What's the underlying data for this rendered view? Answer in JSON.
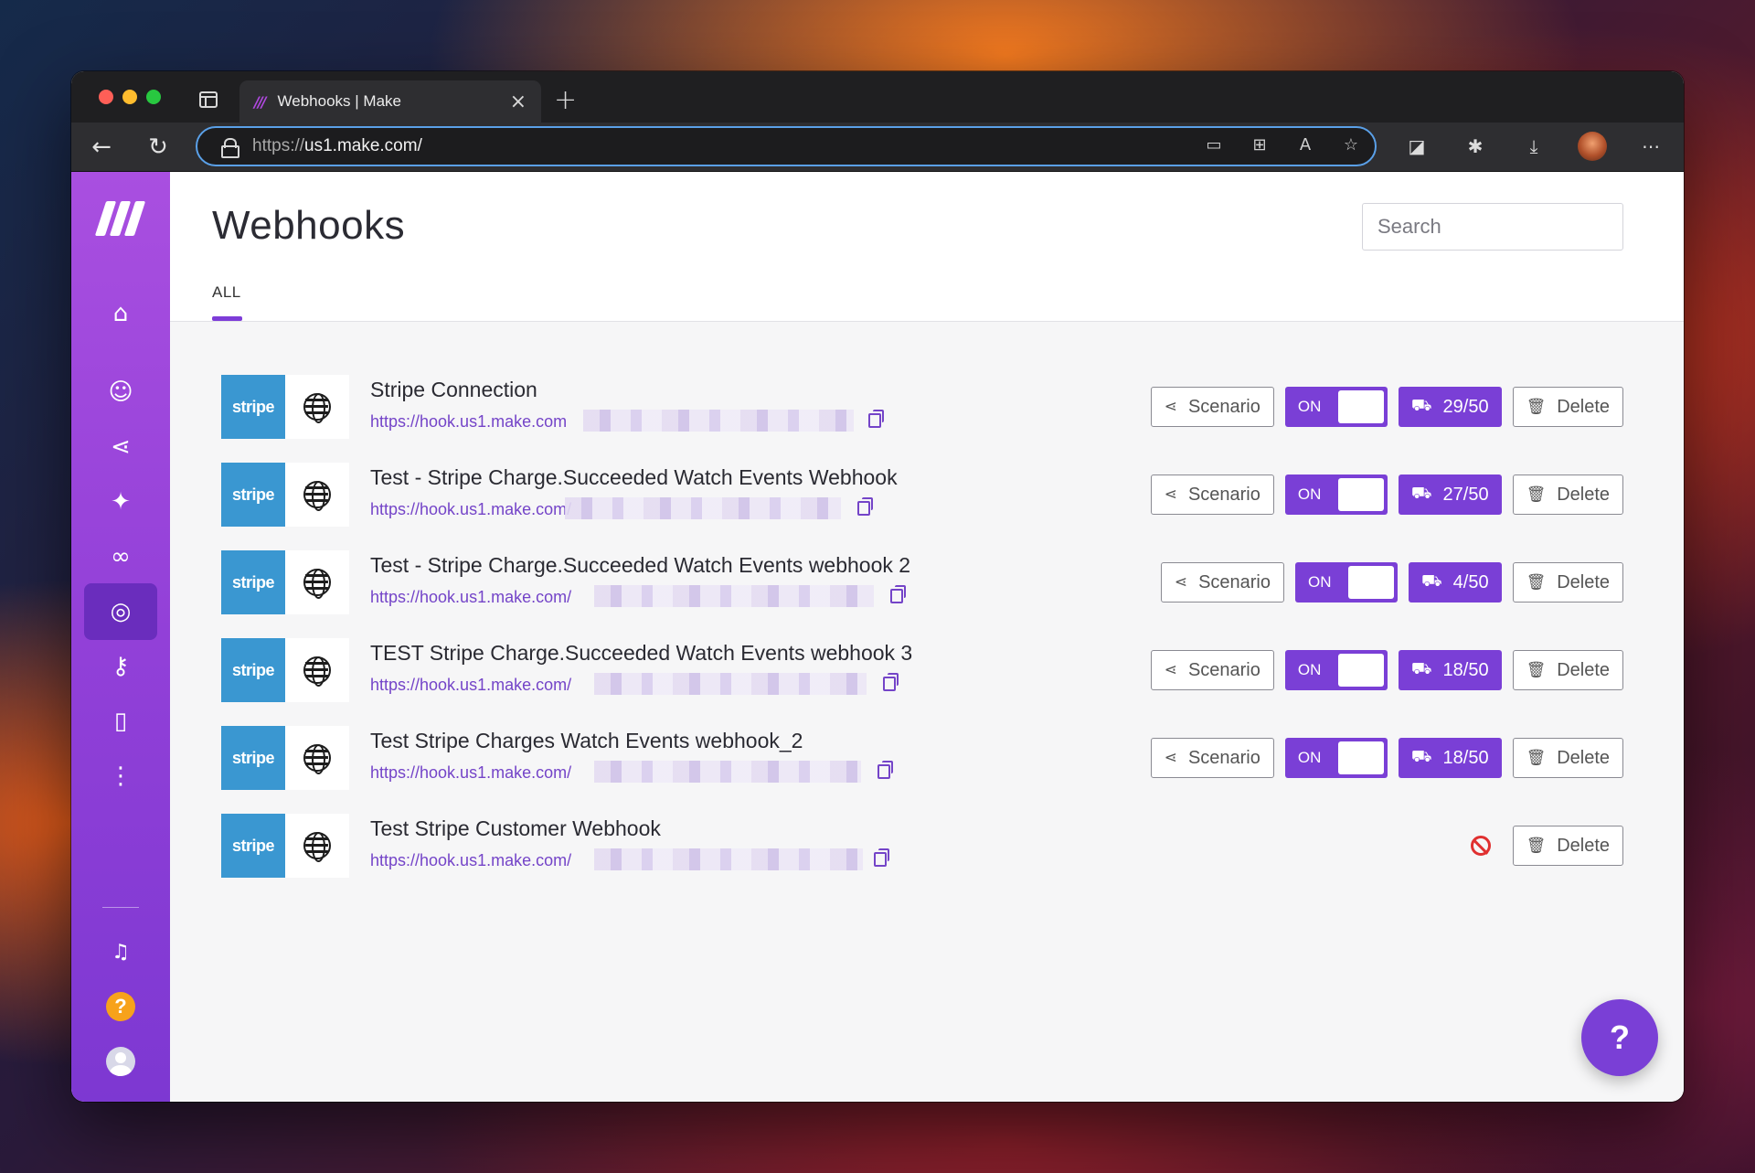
{
  "browser": {
    "tab_title": "Webhooks | Make",
    "tab_favicon": "make-logo-icon",
    "url_scheme": "https://",
    "url_host": "us1.make.com/",
    "new_tab_glyph": "+",
    "close_glyph": "×"
  },
  "page": {
    "title": "Webhooks",
    "search_placeholder": "Search",
    "tabs": [
      {
        "label": "ALL",
        "active": true
      }
    ]
  },
  "sidebar": {
    "items": [
      {
        "name": "home",
        "icon": "home-icon",
        "glyph": "⌂"
      },
      {
        "name": "team",
        "icon": "users-icon",
        "glyph": "☺"
      },
      {
        "name": "scenarios",
        "icon": "share-icon",
        "glyph": "⋖"
      },
      {
        "name": "apps",
        "icon": "puzzle-icon",
        "glyph": "✦"
      },
      {
        "name": "connections",
        "icon": "link-icon",
        "glyph": "∞"
      },
      {
        "name": "webhooks",
        "icon": "globe-icon",
        "glyph": "◎",
        "active": true
      },
      {
        "name": "keys",
        "icon": "key-icon",
        "glyph": "⚷"
      },
      {
        "name": "devices",
        "icon": "mobile-icon",
        "glyph": "▯"
      },
      {
        "name": "more",
        "icon": "more-icon",
        "glyph": "⋮"
      }
    ],
    "bottom": [
      {
        "name": "notifications",
        "icon": "bell-icon",
        "glyph": "🔔"
      },
      {
        "name": "help",
        "icon": "help-icon",
        "glyph": "?"
      },
      {
        "name": "profile",
        "icon": "avatar-icon"
      }
    ]
  },
  "webhooks": [
    {
      "brand": "stripe",
      "name": "Stripe Connection",
      "url": "https://hook.us1.make.com",
      "scenario_label": "Scenario",
      "status": "ON",
      "ops": "29/50",
      "delete_label": "Delete",
      "has_scenario": true
    },
    {
      "brand": "stripe",
      "name": "Test - Stripe Charge.Succeeded Watch Events Webhook",
      "url": "https://hook.us1.make.com/",
      "scenario_label": "Scenario",
      "status": "ON",
      "ops": "27/50",
      "delete_label": "Delete",
      "has_scenario": true
    },
    {
      "brand": "stripe",
      "name": "Test - Stripe Charge.Succeeded Watch Events webhook 2",
      "url": "https://hook.us1.make.com/",
      "scenario_label": "Scenario",
      "status": "ON",
      "ops": "4/50",
      "delete_label": "Delete",
      "has_scenario": true
    },
    {
      "brand": "stripe",
      "name": "TEST Stripe Charge.Succeeded Watch Events webhook 3",
      "url": "https://hook.us1.make.com/",
      "scenario_label": "Scenario",
      "status": "ON",
      "ops": "18/50",
      "delete_label": "Delete",
      "has_scenario": true
    },
    {
      "brand": "stripe",
      "name": "Test Stripe Charges Watch Events webhook_2",
      "url": "https://hook.us1.make.com/",
      "scenario_label": "Scenario",
      "status": "ON",
      "ops": "18/50",
      "delete_label": "Delete",
      "has_scenario": true
    },
    {
      "brand": "stripe",
      "name": "Test Stripe Customer Webhook",
      "url": "https://hook.us1.make.com/",
      "delete_label": "Delete",
      "has_scenario": false
    }
  ],
  "icons": {
    "scenario": "share-icon",
    "ops": "truck-icon",
    "delete": "trash-icon",
    "copy": "copy-icon",
    "disabled": "disabled-icon",
    "chat": "chat-icon"
  },
  "colors": {
    "accent": "#7a3fd6",
    "sidebar_top": "#a94fe0",
    "stripe_blue": "#3a97d1",
    "link": "#7444c8",
    "disabled_red": "#e03030"
  }
}
